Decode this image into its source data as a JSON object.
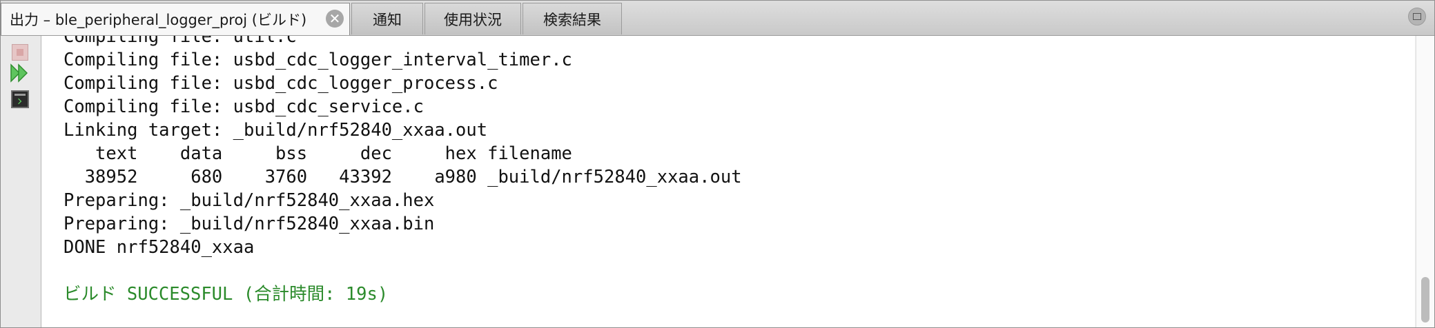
{
  "tabs": [
    {
      "label": "出力 – ble_peripheral_logger_proj (ビルド)",
      "active": true
    },
    {
      "label": "通知",
      "active": false
    },
    {
      "label": "使用状況",
      "active": false
    },
    {
      "label": "検索結果",
      "active": false
    }
  ],
  "tab_close_glyph": "✕",
  "icons": [
    "stop-icon",
    "rerun-icon",
    "terminal-icon",
    "close-icon",
    "maximize-icon"
  ],
  "output": {
    "lines": [
      "Compiling file: util.c",
      "Compiling file: usbd_cdc_logger_interval_timer.c",
      "Compiling file: usbd_cdc_logger_process.c",
      "Compiling file: usbd_cdc_service.c",
      "Linking target: _build/nrf52840_xxaa.out",
      "   text    data     bss     dec     hex filename",
      "  38952     680    3760   43392    a980 _build/nrf52840_xxaa.out",
      "Preparing: _build/nrf52840_xxaa.hex",
      "Preparing: _build/nrf52840_xxaa.bin",
      "DONE nrf52840_xxaa",
      "",
      "ビルド SUCCESSFUL (合計時間: 19s)"
    ],
    "success_color": "#2a8a2a"
  },
  "scrollbar": {
    "position_fraction": 1.0
  }
}
